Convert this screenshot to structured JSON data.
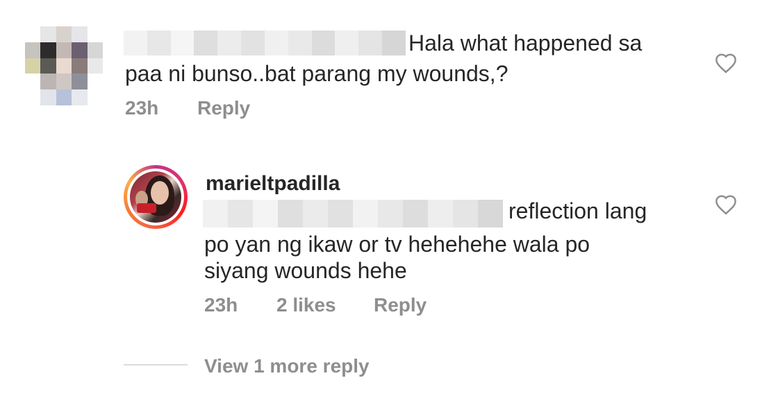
{
  "comment": {
    "text_line1": "Hala what happened sa",
    "text_line2": "paa ni bunso..bat parang my wounds,?",
    "time": "23h",
    "reply_label": "Reply",
    "like_icon": "heart-outline-icon"
  },
  "reply": {
    "username": "marieltpadilla",
    "text_line1": "reflection lang",
    "text_line2": "po yan ng ikaw or tv hehehehe wala po",
    "text_line3": "siyang wounds hehe",
    "time": "23h",
    "likes": "2 likes",
    "reply_label": "Reply",
    "like_icon": "heart-outline-icon"
  },
  "view_more_replies": "View 1 more reply",
  "colors": {
    "text": "#262626",
    "meta": "#8e8e8e",
    "divider": "#dbdbdb"
  }
}
